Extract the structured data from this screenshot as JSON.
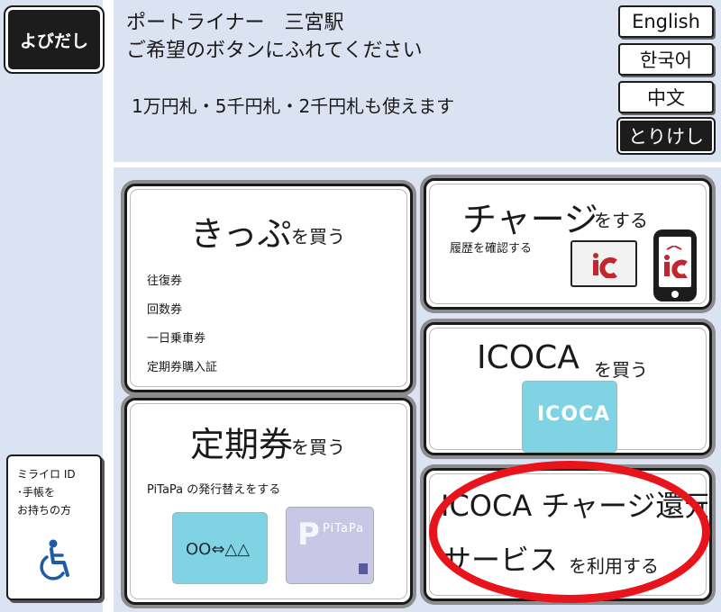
{
  "left": {
    "call_button": "よびだし",
    "mirairo": {
      "line1": "ミライロ ID",
      "line2": "･手帳を",
      "line3": "お持ちの方",
      "icon": "wheelchair-icon"
    }
  },
  "header": {
    "line1": "ポートライナー　三宮駅",
    "line2": "ご希望のボタンにふれてください",
    "line3": "1万円札・5千円札・2千円札も使えます"
  },
  "lang": {
    "english": "English",
    "korean": "한국어",
    "chinese": "中文",
    "cancel": "とりけし"
  },
  "cards": {
    "kippu": {
      "title": "きっぷ",
      "suffix": "を買う",
      "items": [
        "往復券",
        "回数券",
        "一日乗車券",
        "定期券購入証"
      ]
    },
    "teiki": {
      "title": "定期券",
      "suffix": "を買う",
      "note": "PiTaPa の発行替えをする",
      "icoca_card_text": "OO⇔△△",
      "pitapa_card_text": "PiTaPa"
    },
    "charge": {
      "title": "チャージ",
      "suffix": "をする",
      "note": "履歴を確認する"
    },
    "icoca": {
      "title": "ICOCA",
      "suffix": "を買う",
      "card_text": "ICOCA"
    },
    "service": {
      "title": "ICOCA チャージ還元",
      "title2": "サービス",
      "suffix": "を利用する"
    }
  },
  "colors": {
    "panel_bg": "#dbe3f2",
    "button_dark": "#1c1c1c",
    "highlight_red": "#e8141c",
    "icoca_blue": "#7fd3e3",
    "pitapa_lavender": "#c9c7e6"
  }
}
